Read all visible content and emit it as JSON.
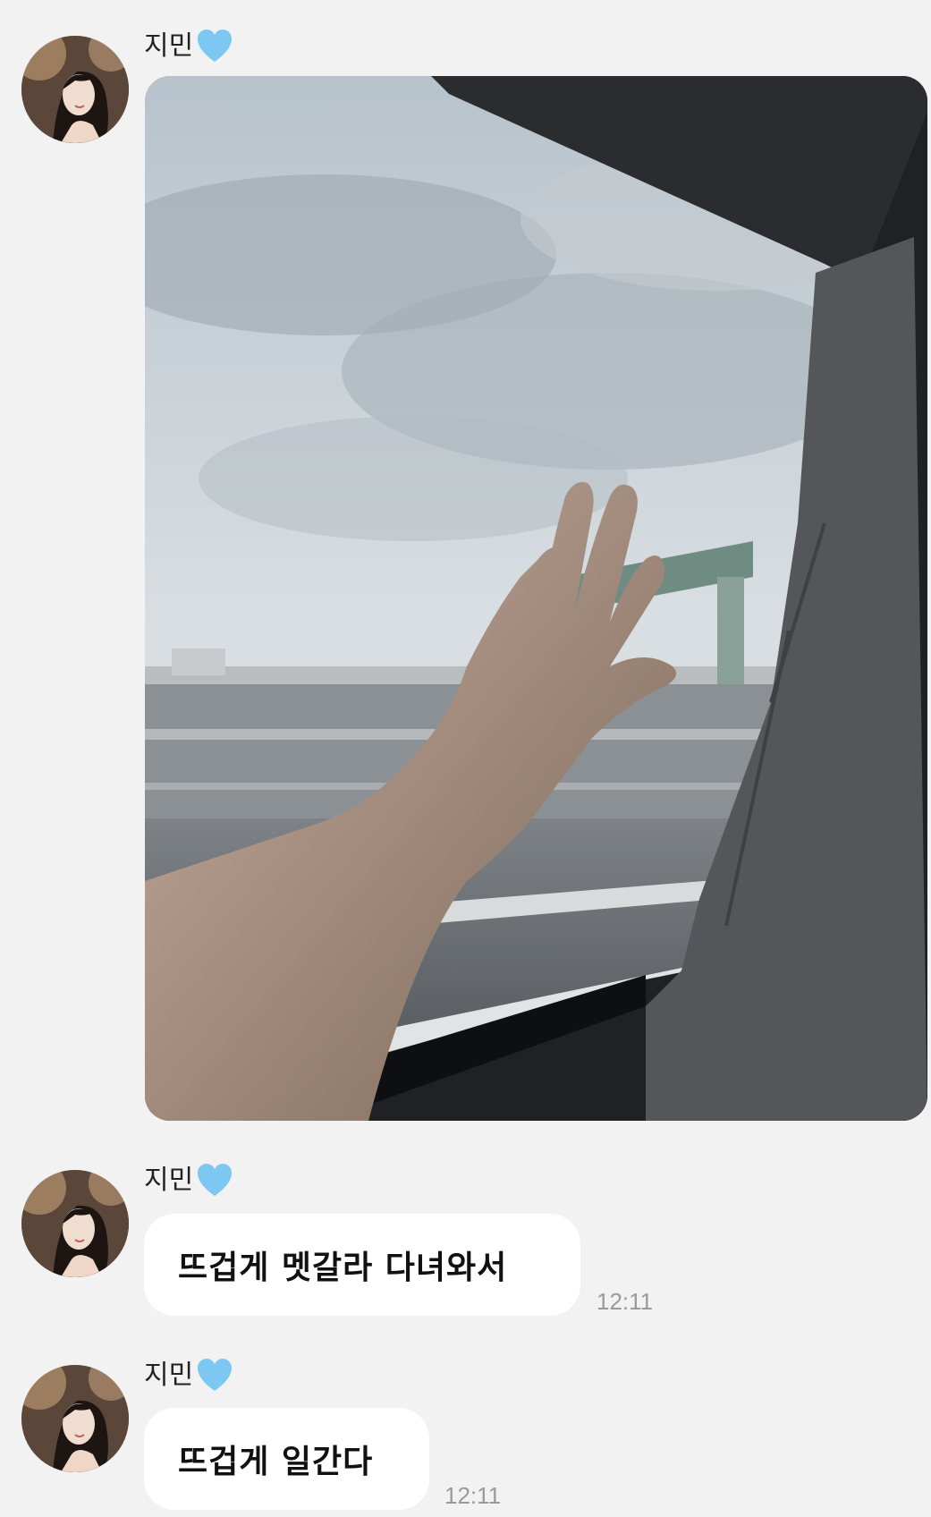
{
  "messages": [
    {
      "sender": "지민",
      "type": "photo",
      "photo_alt": "hand reaching out of a car window on a highway under cloudy sky"
    },
    {
      "sender": "지민",
      "type": "text",
      "text": "뜨겁게 멧갈라 다녀와서",
      "time": "12:11"
    },
    {
      "sender": "지민",
      "type": "text",
      "text": "뜨겁게 일간다",
      "time": "12:11"
    }
  ],
  "colors": {
    "background": "#f2f2f2",
    "bubble": "#ffffff",
    "heart": "#7cc8f2",
    "time": "#9a9a9a"
  },
  "icons": [
    "light-blue-heart-icon",
    "profile-avatar"
  ]
}
